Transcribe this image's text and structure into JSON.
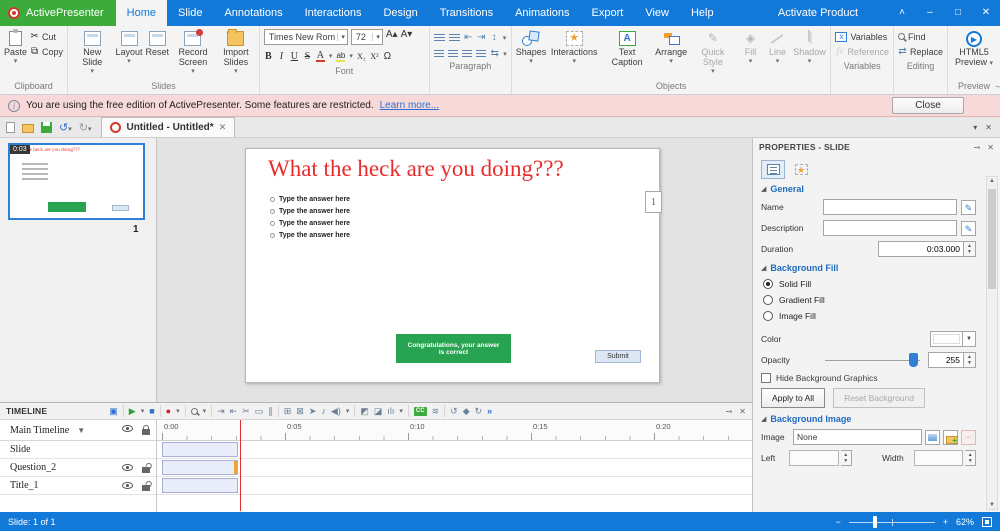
{
  "titlebar": {
    "app_name": "ActivePresenter",
    "tabs": [
      "Home",
      "Slide",
      "Annotations",
      "Interactions",
      "Design",
      "Transitions",
      "Animations",
      "Export",
      "View",
      "Help"
    ],
    "activate_label": "Activate Product"
  },
  "ribbon": {
    "clipboard": {
      "group_label": "Clipboard",
      "paste_label": "Paste",
      "cut_label": "Cut",
      "copy_label": "Copy"
    },
    "slides": {
      "group_label": "Slides",
      "new_slide": "New Slide",
      "layout": "Layout",
      "reset": "Reset",
      "record_screen": "Record Screen",
      "import_slides": "Import Slides"
    },
    "font": {
      "group_label": "Font",
      "family_value": "Times New Rom",
      "size_value": "72",
      "bold": "B",
      "italic": "I",
      "underline": "U",
      "strike": "S",
      "font_color": "A",
      "highlight": "ab",
      "subscript": "X₂",
      "superscript": "X²",
      "symbol": "Ω"
    },
    "paragraph": {
      "group_label": "Paragraph"
    },
    "objects": {
      "group_label": "Objects",
      "shapes": "Shapes",
      "interactions": "Interactions",
      "text_caption": "Text Caption",
      "arrange": "Arrange",
      "quick_style": "Quick Style",
      "fill": "Fill",
      "line": "Line",
      "shadow": "Shadow",
      "caption_letter": "A",
      "star": "★"
    },
    "variables": {
      "group_label": "Variables",
      "variables": "Variables",
      "reference": "Reference",
      "fx": "fx",
      "x": "x"
    },
    "editing": {
      "group_label": "Editing",
      "find": "Find",
      "replace": "Replace"
    },
    "preview": {
      "group_label": "Preview",
      "line1": "HTML5",
      "line2": "Preview"
    }
  },
  "notice": {
    "text": "You are using the free edition of ActivePresenter. Some features are restricted.",
    "link_label": "Learn more...",
    "close_label": "Close"
  },
  "docbar": {
    "tab_title": "Untitled - Untitled*"
  },
  "slide_panel": {
    "duration_badge": "0:03",
    "slide_number": "1"
  },
  "canvas": {
    "title": "What the heck are you doing???",
    "options": [
      "Type the answer here",
      "Type the answer here",
      "Type the answer here",
      "Type the answer here"
    ],
    "feedback_text": "Congratulations, your answer is correct",
    "submit_label": "Submit",
    "page_number": "1"
  },
  "properties": {
    "panel_title": "PROPERTIES - SLIDE",
    "general": {
      "section_label": "General",
      "name_label": "Name",
      "description_label": "Description",
      "duration_label": "Duration",
      "duration_value": "0:03.000"
    },
    "background_fill": {
      "section_label": "Background Fill",
      "solid": "Solid Fill",
      "gradient": "Gradient Fill",
      "image": "Image Fill",
      "selected": "Solid Fill",
      "color_label": "Color",
      "opacity_label": "Opacity",
      "opacity_value": "255",
      "hide_graphics_label": "Hide Background Graphics",
      "apply_all_label": "Apply to All",
      "reset_label": "Reset Background"
    },
    "background_image": {
      "section_label": "Background Image",
      "image_label": "Image",
      "image_value": "None",
      "left_label": "Left",
      "width_label": "Width"
    }
  },
  "timeline": {
    "panel_title": "TIMELINE",
    "timeline_selector": "Main Timeline",
    "rows": [
      "Slide",
      "Question_2",
      "Title_1"
    ],
    "ruler_labels": [
      "0:00",
      "0:05",
      "0:10",
      "0:15",
      "0:20"
    ],
    "cc_icon_label": "CC"
  },
  "statusbar": {
    "slide_indicator": "Slide: 1 of 1",
    "zoom_value": "62%"
  },
  "colors": {
    "accent_blue": "#1379d8",
    "brand_green": "#3cab3c",
    "title_red": "#e82c2c",
    "feedback_green": "#28a352",
    "notice_pink": "#f7d9d9"
  }
}
